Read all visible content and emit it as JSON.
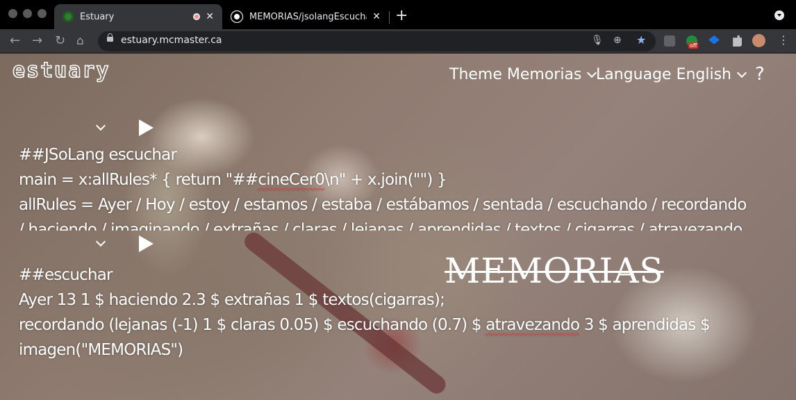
{
  "browser": {
    "tabs": [
      {
        "title": "Estuary",
        "favicon_color": "#2e7d32"
      },
      {
        "title": "MEMORIAS/jsolangEscuchar.pde",
        "favicon_color": "#ffffff"
      }
    ],
    "new_tab_symbol": "+",
    "url": "estuary.mcmaster.ca",
    "extension_badge": "off"
  },
  "site": {
    "logo": "estuary",
    "theme_menu": "Theme Memorias",
    "language_menu": "Language English",
    "help_symbol": "?"
  },
  "editor1": {
    "lines": [
      "##JSoLang escuchar",
      [
        "main = x:allRules* { return \"##",
        "cineCer0",
        "\\n\" + x.join(\"\") }"
      ],
      "allRules = Ayer / Hoy / estoy / estamos / estaba / estábamos / sentada / escuchando / recordando",
      "/ haciendo / imaginando / extrañas / claras / lejanas / aprendidas / textos / cigarras / atravezando"
    ]
  },
  "editor2": {
    "lines": [
      "##escuchar",
      "Ayer 13 1 $ haciendo 2.3 $ extrañas 1 $ textos(cigarras);",
      [
        "recordando (lejanas (-1) 1 $ claras 0.05) $ escuchando (0.7) $ ",
        "atravezando",
        " 3 $ aprendidas $"
      ],
      "imagen(\"MEMORIAS\")"
    ]
  },
  "overlay_text": "MEMORIAS",
  "colors": {
    "chrome_bg": "#000000",
    "toolbar_bg": "#35363a",
    "spellcheck": "#e0413a",
    "star": "#8ab4f8"
  }
}
